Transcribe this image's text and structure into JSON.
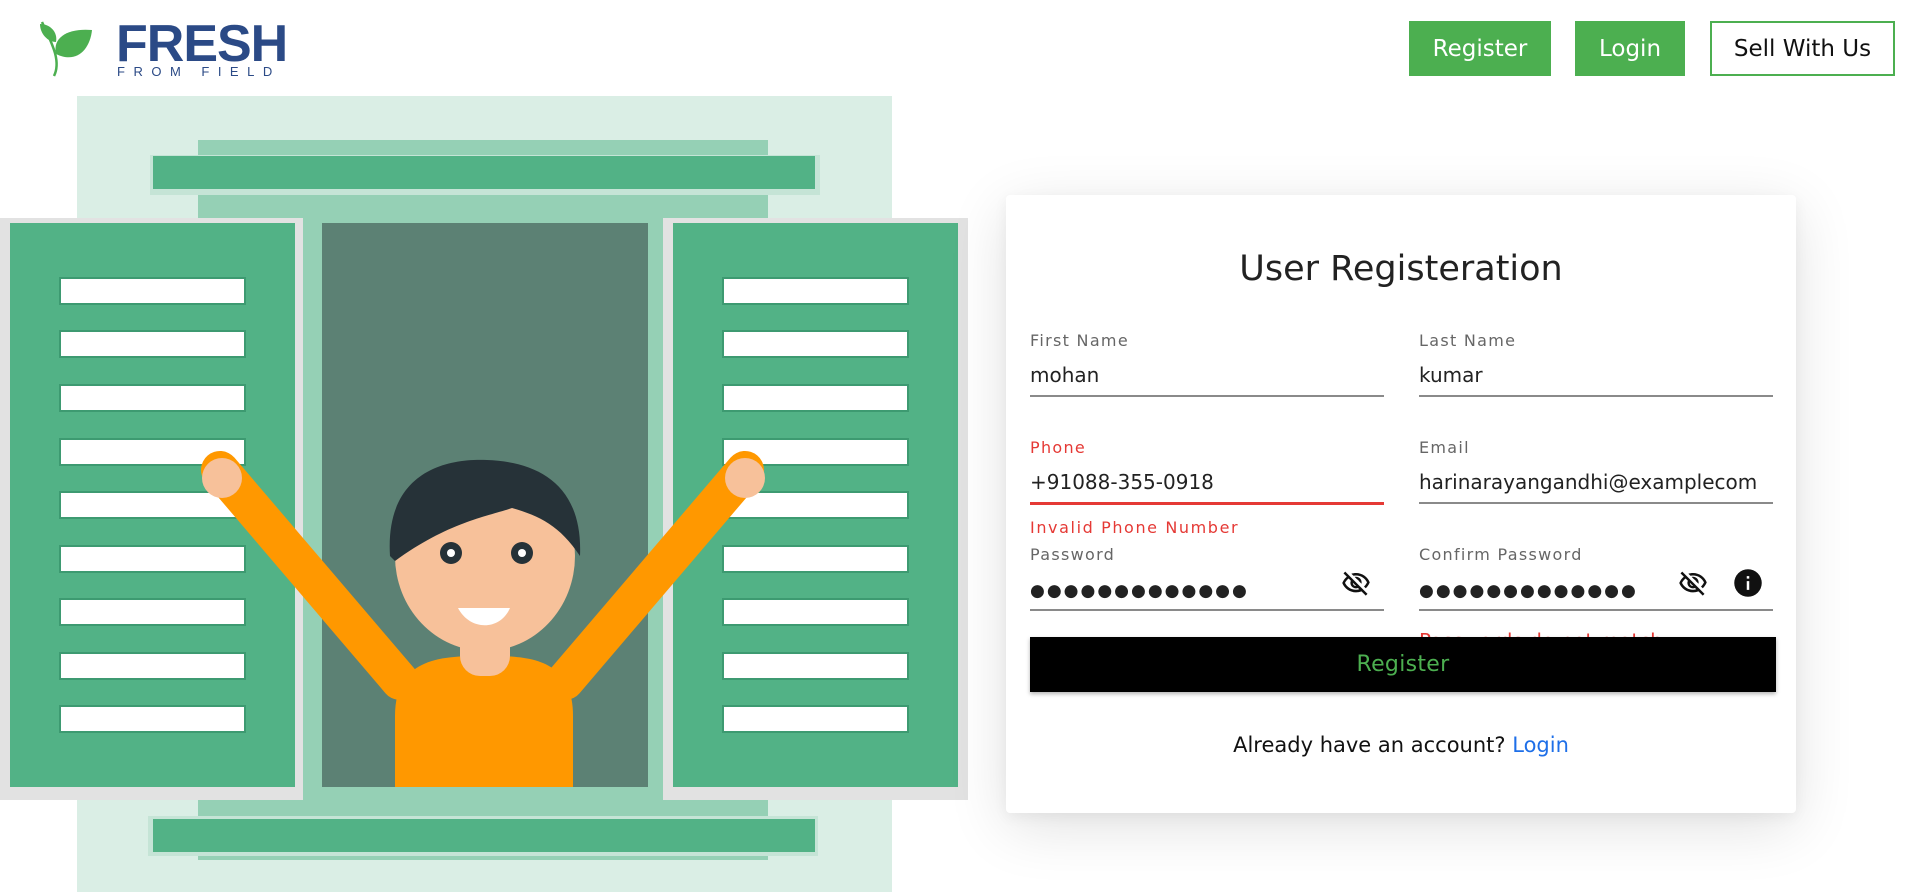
{
  "brand": {
    "name": "FRESH",
    "tagline": "FROM FIELD",
    "leaf_color": "#4caf50",
    "text_color": "#2b4a86"
  },
  "header": {
    "register_label": "Register",
    "login_label": "Login",
    "sell_label": "Sell With Us"
  },
  "form": {
    "title": "User Registeration",
    "first_name": {
      "label": "First Name",
      "value": "mohan"
    },
    "last_name": {
      "label": "Last Name",
      "value": "kumar"
    },
    "phone": {
      "label": "Phone",
      "value": "+91088-355-0918",
      "error": "Invalid Phone Number"
    },
    "email": {
      "label": "Email",
      "value": "harinarayangandhi@examplecom"
    },
    "password": {
      "label": "Password",
      "value": "●●●●●●●●●●●●●",
      "icon": "eye-off-icon"
    },
    "confirm_password": {
      "label": "Confirm Password",
      "value": "●●●●●●●●●●●●●",
      "icon": "eye-off-icon",
      "info_icon": "info-icon",
      "error": "Passwords do not match"
    },
    "submit_label": "Register",
    "footer_text": "Already have an account?",
    "footer_link": "Login"
  },
  "colors": {
    "accent": "#4caf50",
    "error": "#e53935",
    "link": "#1e6fe8",
    "submit_bg": "#000000"
  }
}
